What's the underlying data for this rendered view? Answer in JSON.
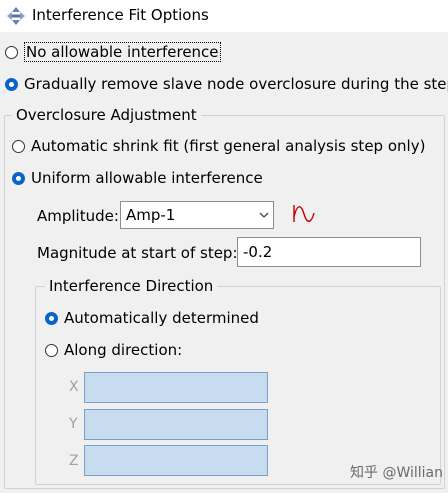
{
  "window": {
    "title": "Interference Fit Options"
  },
  "options": {
    "no_interference": "No allowable interference",
    "gradual_remove": "Gradually remove slave node overclosure during the step"
  },
  "overclosure": {
    "legend": "Overclosure Adjustment",
    "auto_shrink": "Automatic shrink fit (first general analysis step only)",
    "uniform": "Uniform allowable interference",
    "amplitude_label": "Amplitude:",
    "amplitude_value": "Amp-1",
    "magnitude_label": "Magnitude at start of step:",
    "magnitude_value": "-0.2"
  },
  "direction": {
    "legend": "Interference Direction",
    "auto": "Automatically determined",
    "along": "Along direction:",
    "axes": [
      "X",
      "Y",
      "Z"
    ]
  },
  "watermark": "知乎 @Willian",
  "colors": {
    "accent": "#0a64c8",
    "disabled_field": "#c8dcf0",
    "amp_icon": "#c00000"
  }
}
